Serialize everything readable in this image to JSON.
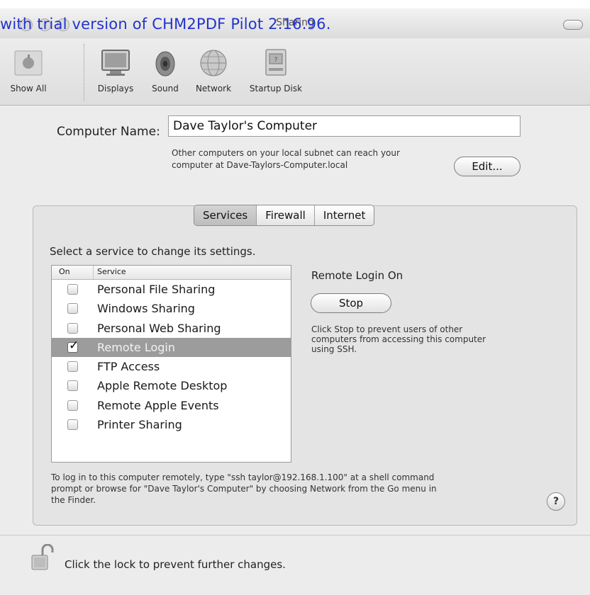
{
  "watermark": "with trial version of CHM2PDF Pilot 2.16.96.",
  "window": {
    "title": "Sharing"
  },
  "toolbar": {
    "items": [
      {
        "label": "Show All",
        "icon": "apple-icon"
      },
      {
        "label": "Displays",
        "icon": "display-icon"
      },
      {
        "label": "Sound",
        "icon": "speaker-icon"
      },
      {
        "label": "Network",
        "icon": "globe-icon"
      },
      {
        "label": "Startup Disk",
        "icon": "disk-icon"
      }
    ]
  },
  "computer_name": {
    "label": "Computer Name:",
    "value": "Dave Taylor's Computer",
    "note_line1": "Other computers on your local subnet can reach your",
    "note_line2": "computer at Dave-Taylors-Computer.local",
    "edit_label": "Edit..."
  },
  "tabs": [
    {
      "label": "Services",
      "active": true
    },
    {
      "label": "Firewall",
      "active": false
    },
    {
      "label": "Internet",
      "active": false
    }
  ],
  "services": {
    "instruction": "Select a service to change its settings.",
    "col_on": "On",
    "col_service": "Service",
    "rows": [
      {
        "name": "Personal File Sharing",
        "checked": false,
        "selected": false
      },
      {
        "name": "Windows Sharing",
        "checked": false,
        "selected": false
      },
      {
        "name": "Personal Web Sharing",
        "checked": false,
        "selected": false
      },
      {
        "name": "Remote Login",
        "checked": true,
        "selected": true
      },
      {
        "name": "FTP Access",
        "checked": false,
        "selected": false
      },
      {
        "name": "Apple Remote Desktop",
        "checked": false,
        "selected": false
      },
      {
        "name": "Remote Apple Events",
        "checked": false,
        "selected": false
      },
      {
        "name": "Printer Sharing",
        "checked": false,
        "selected": false
      }
    ]
  },
  "detail": {
    "status": "Remote Login On",
    "button_label": "Stop",
    "description_line1": "Click Stop to prevent users of other",
    "description_line2": "computers from accessing this computer",
    "description_line3": "using SSH."
  },
  "footer": {
    "line1": "To log in to this computer remotely, type \"ssh taylor@192.168.1.100\" at a shell command",
    "line2": "prompt or browse for \"Dave Taylor's Computer\" by choosing Network from the Go menu in",
    "line3": "the Finder.",
    "help_label": "?",
    "lock_text": "Click the lock to prevent further changes."
  }
}
